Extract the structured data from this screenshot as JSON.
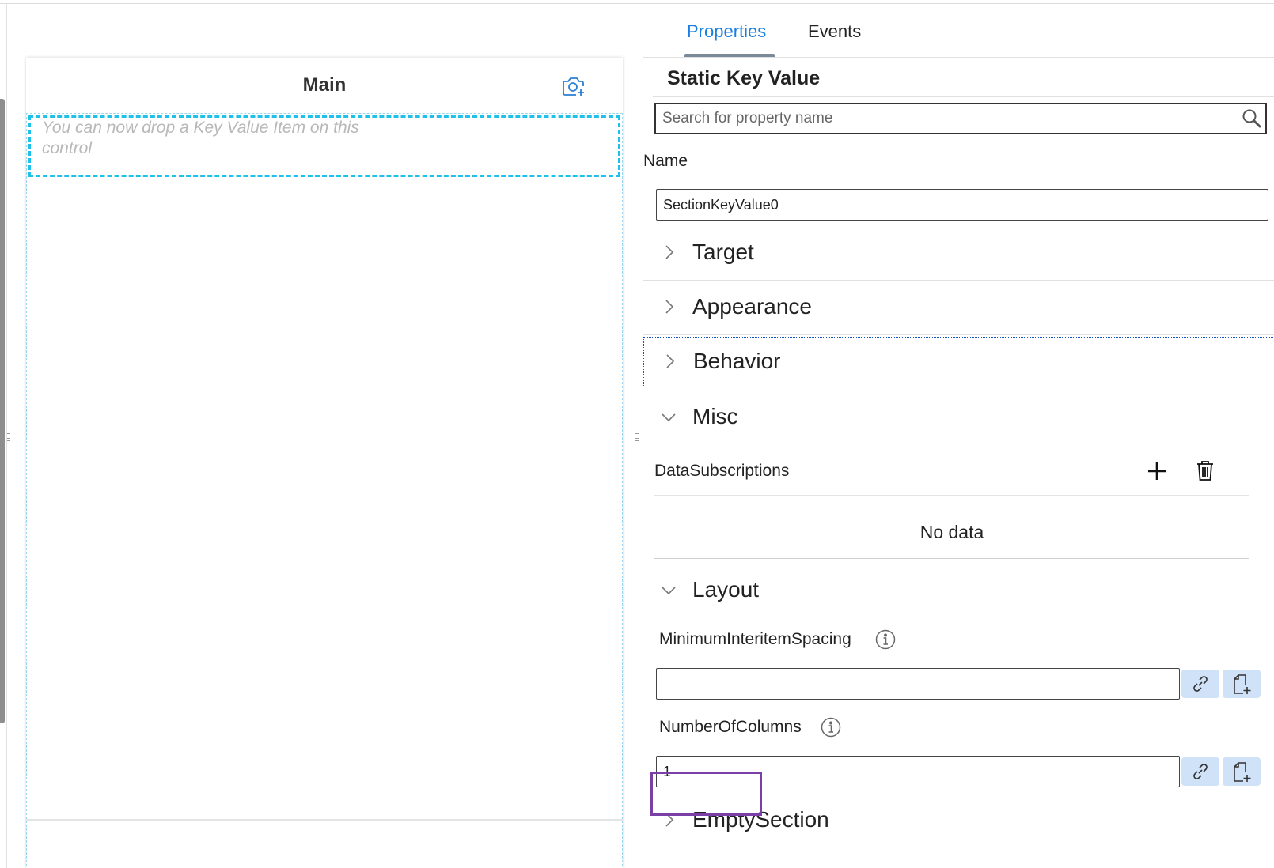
{
  "preview": {
    "title": "Main",
    "drop_hint": "You can now drop a Key Value Item on this control",
    "camera_icon": "camera-add-icon"
  },
  "tabs": [
    {
      "label": "Properties",
      "active": true
    },
    {
      "label": "Events",
      "active": false
    }
  ],
  "panel": {
    "title": "Static Key Value",
    "search_placeholder": "Search for property name",
    "name_label": "Name",
    "name_value": "SectionKeyValue0"
  },
  "sections": {
    "target": "Target",
    "appearance": "Appearance",
    "behavior": "Behavior",
    "misc": "Misc",
    "layout": "Layout",
    "empty_section": "EmptySection"
  },
  "misc": {
    "data_subscriptions_label": "DataSubscriptions",
    "empty_text": "No data"
  },
  "layout": {
    "min_spacing_label": "MinimumInteritemSpacing",
    "min_spacing_value": "",
    "columns_label": "NumberOfColumns",
    "columns_value": "1"
  },
  "colors": {
    "accent": "#1a7fe0",
    "drop_border": "#1ec1ea",
    "highlight": "#7b3fa8",
    "button_bg": "#cfe2f7"
  }
}
